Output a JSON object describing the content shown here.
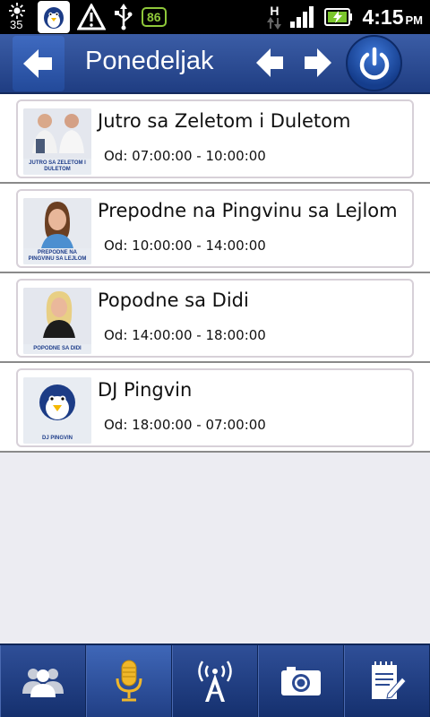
{
  "status_bar": {
    "temperature": "35",
    "battery_badge": "86",
    "network_letter": "H",
    "time": "4:15",
    "ampm": "PM"
  },
  "header": {
    "title": "Ponedeljak",
    "accent_color": "#2a4d9a"
  },
  "shows": [
    {
      "title": "Jutro sa Zeletom i Duletom",
      "time": "Od: 07:00:00 - 10:00:00",
      "thumb_caption": "JUTRO SA ZELETOM I DULETOM"
    },
    {
      "title": "Prepodne na Pingvinu sa Lejlom",
      "time": "Od: 10:00:00 - 14:00:00",
      "thumb_caption": "PREPODNE NA PINGVINU SA LEJLOM"
    },
    {
      "title": "Popodne sa Didi",
      "time": "Od: 14:00:00 - 18:00:00",
      "thumb_caption": "POPODNE SA DIDI"
    },
    {
      "title": "DJ Pingvin",
      "time": "Od: 18:00:00 - 07:00:00",
      "thumb_caption": "DJ PINGVIN"
    }
  ],
  "tabs": [
    {
      "icon": "people-icon"
    },
    {
      "icon": "microphone-icon",
      "active": true
    },
    {
      "icon": "radio-tower-icon"
    },
    {
      "icon": "camera-icon"
    },
    {
      "icon": "notepad-icon"
    }
  ]
}
